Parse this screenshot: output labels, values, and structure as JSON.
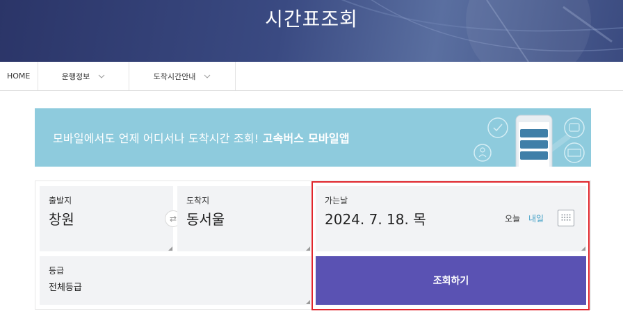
{
  "header": {
    "title": "시간표조회"
  },
  "nav": {
    "home": "HOME",
    "menu1": "운행정보",
    "menu2": "도착시간안내"
  },
  "banner": {
    "text": "모바일에서도 언제 어디서나 도착시간 조회!",
    "strong": "고속버스 모바일앱"
  },
  "form": {
    "departure": {
      "label": "출발지",
      "value": "창원"
    },
    "arrival": {
      "label": "도착지",
      "value": "동서울"
    },
    "date": {
      "label": "가는날",
      "value": "2024. 7. 18. 목",
      "today": "오늘",
      "tomorrow": "내일"
    },
    "grade": {
      "label": "등급",
      "value": "전체등급"
    },
    "search_label": "조회하기"
  },
  "colors": {
    "hero": "#2b3568",
    "banner": "#8ecbdd",
    "button": "#5a52b3",
    "highlight": "#e0262c"
  }
}
